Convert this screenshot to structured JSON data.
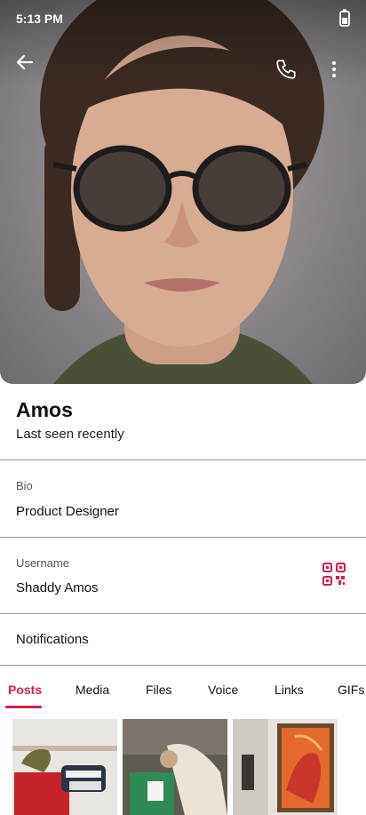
{
  "status_bar": {
    "time": "5:13 PM"
  },
  "profile": {
    "name": "Amos",
    "last_seen": "Last seen recently"
  },
  "bio": {
    "label": "Bio",
    "value": "Product Designer"
  },
  "username": {
    "label": "Username",
    "value": "Shaddy Amos"
  },
  "notifications": {
    "label": "Notifications"
  },
  "tabs": [
    {
      "label": "Posts",
      "active": true
    },
    {
      "label": "Media",
      "active": false
    },
    {
      "label": "Files",
      "active": false
    },
    {
      "label": "Voice",
      "active": false
    },
    {
      "label": "Links",
      "active": false
    },
    {
      "label": "GIFs",
      "active": false
    }
  ],
  "colors": {
    "accent": "#d81b4d",
    "divider": "#9a9a9a"
  },
  "icons": [
    "back-arrow-icon",
    "phone-icon",
    "more-vertical-icon",
    "battery-icon",
    "qr-code-icon"
  ]
}
